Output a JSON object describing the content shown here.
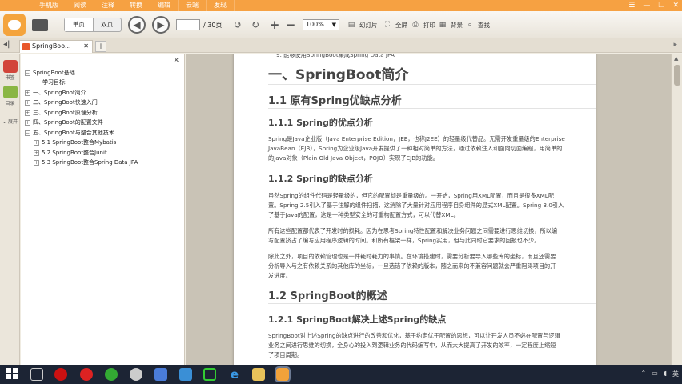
{
  "app": {
    "top_tabs": [
      "手机版",
      "阅读",
      "注释",
      "转换",
      "编辑",
      "云端",
      "发现"
    ],
    "window_controls": [
      "☰",
      "—",
      "❐",
      "✕"
    ]
  },
  "toolbar": {
    "single_page_label": "单页",
    "double_page_label": "双页",
    "current_page": "1",
    "total_pages": "/ 30页",
    "zoom": "100%",
    "slideshow_label": "幻灯片",
    "fullscreen_label": "全屏",
    "print_label": "打印",
    "background_label": "背景",
    "search_label": "查找"
  },
  "tabstrip": {
    "doc_tab_title": "SpringBoo...",
    "new_tab": "+"
  },
  "rail": {
    "bookmark_label": "书签",
    "outline_label": "目录",
    "expand_label": "展开"
  },
  "outline": {
    "items": [
      {
        "label": "SpringBoot基础",
        "toggle": "−"
      },
      {
        "label": "学习目标:",
        "toggle": ""
      },
      {
        "label": "一、SpringBoot简介",
        "toggle": "+"
      },
      {
        "label": "二、SpringBoot快速入门",
        "toggle": "+"
      },
      {
        "label": "三、SpringBoot原理分析",
        "toggle": "+"
      },
      {
        "label": "四、SpringBoot的配置文件",
        "toggle": "+"
      },
      {
        "label": "五、SpringBoot与整合其他技术",
        "toggle": "−"
      },
      {
        "label": "5.1  SpringBoot整合Mybatis",
        "toggle": "+"
      },
      {
        "label": "5.2  SpringBoot整合Junit",
        "toggle": "+"
      },
      {
        "label": "5.3  SpringBoot整合Spring Data JPA",
        "toggle": "+"
      }
    ]
  },
  "document": {
    "top_line": "9. 能够使用SpringBoot集成Spring Data JPA",
    "h1": "一、SpringBoot简介",
    "h2_1": "1.1  原有Spring优缺点分析",
    "h3_1": "1.1.1 Spring的优点分析",
    "p1": [
      "Spring是Java企业版（Java Enterprise Edition，JEE，也称J2EE）的轻量级代替品。无需开发重量级的Enterprise",
      "JavaBean（EJB），Spring为企业级Java开发提供了一种相对简单的方法，通过依赖注入和面向切面编程，用简单的",
      "的Java对象（Plain Old Java Object，POJO）实现了EJB的功能。"
    ],
    "h3_2": "1.1.2 Spring的缺点分析",
    "p2": [
      "虽然Spring的组件代码是轻量级的，但它的配置却是重量级的。一开始，Spring用XML配置，而且是很多XML配",
      "置。Spring 2.5引入了基于注解的组件扫描，这消除了大量针对应用程序自身组件的显式XML配置。Spring 3.0引入",
      "了基于Java的配置，这是一种类型安全的可重构配置方式，可以代替XML。"
    ],
    "p3": [
      "所有这些配置都代表了开发时的损耗。因为在思考Spring特性配置和解决业务问题之间需要进行思维切换，所以编",
      "写配置挤占了编写应用程序逻辑的时间。和所有框架一样，Spring实用，但与此同时它要求的回报也不少。"
    ],
    "p4": [
      "除此之外，项目的依赖管理也是一件耗时耗力的事情。在环境搭建时，需要分析要导入哪些库的坐标，而且还需要",
      "分析导入与之有依赖关系的其他库的坐标，一旦选错了依赖的版本，随之而来的不兼容问题就会严重阻碍项目的开",
      "发进度。"
    ],
    "h2_2": "1.2 SpringBoot的概述",
    "h3_3": "1.2.1 SpringBoot解决上述Spring的缺点",
    "p5": [
      "SpringBoot对上述Spring的缺点进行的改善和优化，基于约定优于配置的思想，可以让开发人员不必在配置与逻辑",
      "业务之间进行思维的切换，全身心的投入到逻辑业务的代码编写中，从而大大提高了开发的效率，一定程度上缩短",
      "了项目周期。"
    ]
  },
  "taskbar": {
    "tray_text": "英"
  },
  "colors": {
    "accent": "#f6a142",
    "taskbar": "#1c2434"
  }
}
